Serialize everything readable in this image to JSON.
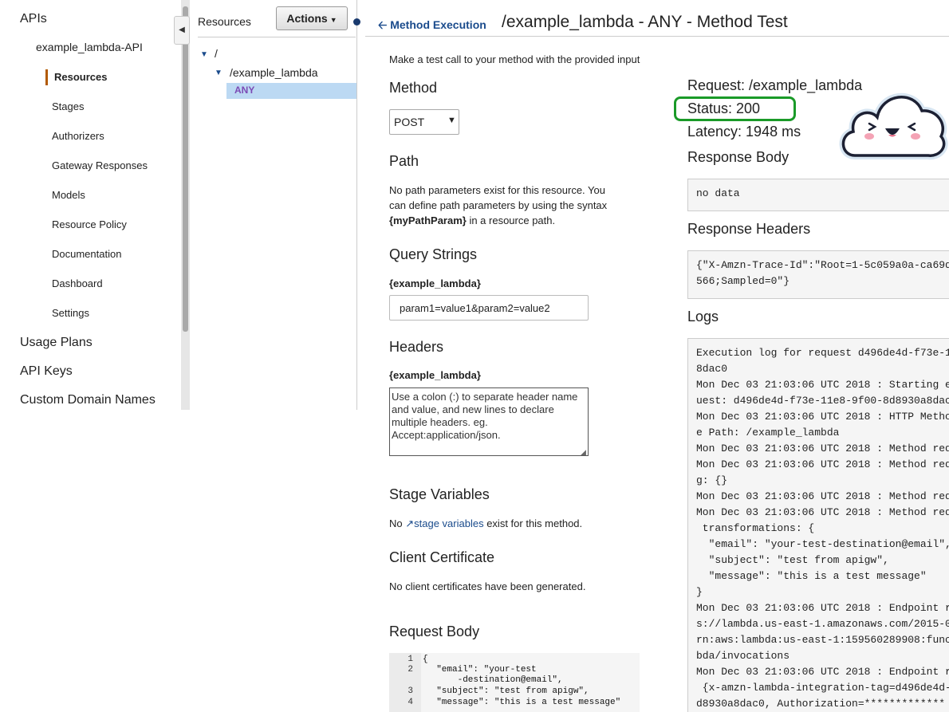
{
  "nav": {
    "apis": "APIs",
    "api_name": "example_lambda-API",
    "items": [
      "Resources",
      "Stages",
      "Authorizers",
      "Gateway Responses",
      "Models",
      "Resource Policy",
      "Documentation",
      "Dashboard",
      "Settings"
    ],
    "usage_plans": "Usage Plans",
    "api_keys": "API Keys",
    "custom_domains": "Custom Domain Names"
  },
  "resources": {
    "title": "Resources",
    "actions": "Actions",
    "root": "/",
    "child": "/example_lambda",
    "method": "ANY"
  },
  "header": {
    "back": "Method Execution",
    "title": "/example_lambda - ANY - Method Test"
  },
  "form": {
    "intro": "Make a test call to your method with the provided input",
    "method_heading": "Method",
    "method_value": "POST",
    "path_heading": "Path",
    "path_text_1": "No path parameters exist for this resource. You",
    "path_text_2": "can define path parameters by using the syntax",
    "path_param": "{myPathParam}",
    "path_text_3": " in a resource path.",
    "query_heading": "Query Strings",
    "query_label": "{example_lambda}",
    "query_value": "param1=value1&param2=value2",
    "headers_heading": "Headers",
    "headers_label": "{example_lambda}",
    "headers_placeholder": "Use a colon (:) to separate header name and value, and new lines to declare multiple headers. eg. Accept:application/json.",
    "stage_heading": "Stage Variables",
    "stage_no": "No ",
    "stage_link": "stage variables",
    "stage_rest": " exist for this method.",
    "cert_heading": "Client Certificate",
    "cert_text": "No client certificates have been generated.",
    "body_heading": "Request Body",
    "body_lines": [
      {
        "n": "1",
        "code": "{"
      },
      {
        "n": "2",
        "code": "  \"email\": \"your-test"
      },
      {
        "n": "",
        "code": "      -destination@email\","
      },
      {
        "n": "3",
        "code": "  \"subject\": \"test from apigw\","
      },
      {
        "n": "4",
        "code": "  \"message\": \"this is a test message\""
      }
    ]
  },
  "response": {
    "request": "Request: /example_lambda",
    "status": "Status: 200",
    "latency": "Latency: 1948 ms",
    "body_heading": "Response Body",
    "body": "no data",
    "headers_heading": "Response Headers",
    "headers": "{\"X-Amzn-Trace-Id\":\"Root=1-5c059a0a-ca69d\n566;Sampled=0\"}",
    "logs_heading": "Logs",
    "logs": "Execution log for request d496de4d-f73e-1\n8dac0\nMon Dec 03 21:03:06 UTC 2018 : Starting e\nuest: d496de4d-f73e-11e8-9f00-8d8930a8dac\nMon Dec 03 21:03:06 UTC 2018 : HTTP Metho\ne Path: /example_lambda\nMon Dec 03 21:03:06 UTC 2018 : Method req\nMon Dec 03 21:03:06 UTC 2018 : Method req\ng: {}\nMon Dec 03 21:03:06 UTC 2018 : Method req\nMon Dec 03 21:03:06 UTC 2018 : Method req\n transformations: {\n  \"email\": \"your-test-destination@email\",\n  \"subject\": \"test from apigw\",\n  \"message\": \"this is a test message\"\n}\nMon Dec 03 21:03:06 UTC 2018 : Endpoint r\ns://lambda.us-east-1.amazonaws.com/2015-0\nrn:aws:lambda:us-east-1:159560289908:func\nbda/invocations\nMon Dec 03 21:03:06 UTC 2018 : Endpoint r\n {x-amzn-lambda-integration-tag=d496de4d-\nd8930a8dac0, Authorization=*************"
  },
  "colors": {
    "link": "#1a4b8c",
    "status_highlight": "#1a9a28",
    "active_marker": "#b25a00",
    "selected_row": "#bcd9f3"
  },
  "icons": [
    "collapse-left-icon",
    "caret-down-icon",
    "arrow-left-icon",
    "external-link-icon",
    "cloud-mascot-icon"
  ]
}
